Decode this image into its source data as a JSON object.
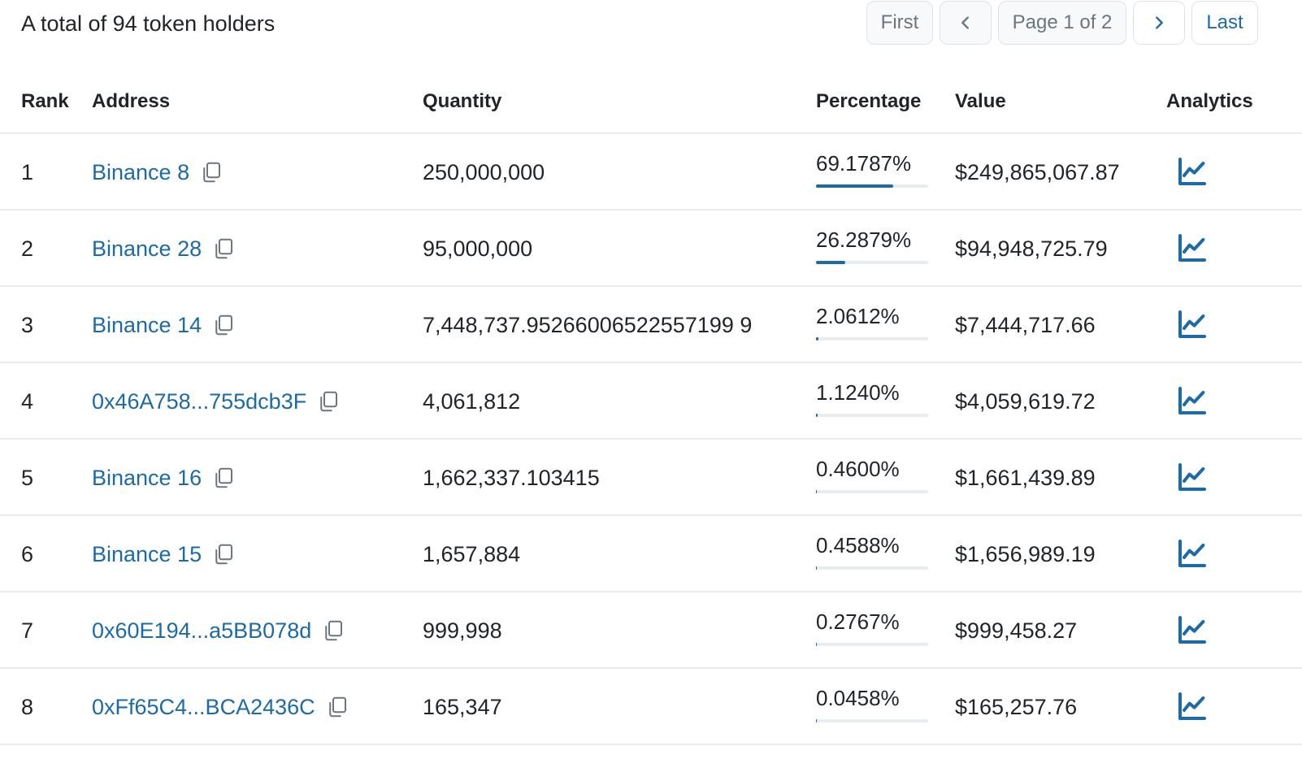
{
  "summary": "A total of 94 token holders",
  "pager": {
    "first": "First",
    "prev_icon": "chevron-left-icon",
    "page": "Page 1 of 2",
    "next_icon": "chevron-right-icon",
    "last": "Last"
  },
  "columns": {
    "rank": "Rank",
    "address": "Address",
    "quantity": "Quantity",
    "percentage": "Percentage",
    "value": "Value",
    "analytics": "Analytics"
  },
  "colors": {
    "link": "#1c6aa8",
    "bar": "#1c6aa8",
    "track": "#e9ecef"
  },
  "rows": [
    {
      "rank": "1",
      "address": "Binance 8",
      "quantity": "250,000,000",
      "percentage": "69.1787%",
      "pct": 69.1787,
      "value": "$249,865,067.87"
    },
    {
      "rank": "2",
      "address": "Binance 28",
      "quantity": "95,000,000",
      "percentage": "26.2879%",
      "pct": 26.2879,
      "value": "$94,948,725.79"
    },
    {
      "rank": "3",
      "address": "Binance 14",
      "quantity": "7,448,737.95266006522557199 9",
      "percentage": "2.0612%",
      "pct": 2.0612,
      "value": "$7,444,717.66"
    },
    {
      "rank": "4",
      "address": "0x46A758...755dcb3F",
      "quantity": "4,061,812",
      "percentage": "1.1240%",
      "pct": 1.124,
      "value": "$4,059,619.72"
    },
    {
      "rank": "5",
      "address": "Binance 16",
      "quantity": "1,662,337.103415",
      "percentage": "0.4600%",
      "pct": 0.46,
      "value": "$1,661,439.89"
    },
    {
      "rank": "6",
      "address": "Binance 15",
      "quantity": "1,657,884",
      "percentage": "0.4588%",
      "pct": 0.4588,
      "value": "$1,656,989.19"
    },
    {
      "rank": "7",
      "address": "0x60E194...a5BB078d",
      "quantity": "999,998",
      "percentage": "0.2767%",
      "pct": 0.2767,
      "value": "$999,458.27"
    },
    {
      "rank": "8",
      "address": "0xFf65C4...BCA2436C",
      "quantity": "165,347",
      "percentage": "0.0458%",
      "pct": 0.0458,
      "value": "$165,257.76"
    }
  ]
}
